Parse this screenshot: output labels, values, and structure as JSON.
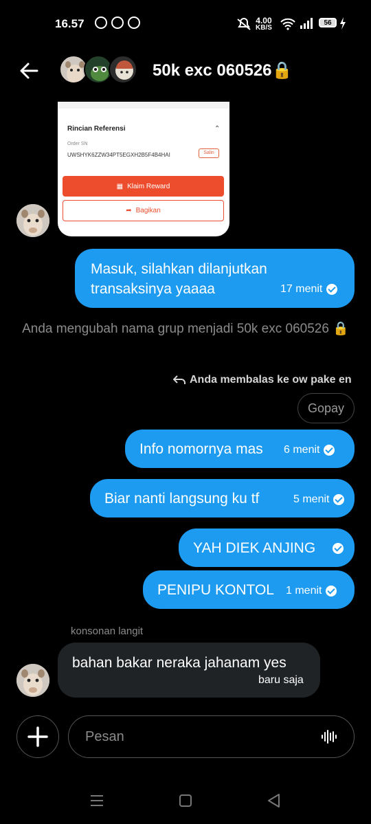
{
  "status_bar": {
    "time": "16.57",
    "speed_value": "4.00",
    "speed_unit": "KB/S",
    "battery": "56"
  },
  "header": {
    "title": "50k exc 060526🔒"
  },
  "image_card": {
    "section_title": "Rincian Referensi",
    "order_label": "Order SN",
    "order_value": "UWSHYK6ZZW34PT5EGXH2B5F4B4HAI",
    "copy_label": "Salin",
    "claim_label": "Klaim Reward",
    "share_label": "Bagikan"
  },
  "messages": [
    {
      "text": "Masuk, silahkan dilanjutkan transaksinya yaaaa",
      "time": "17 menit"
    },
    {
      "text": "Info nomornya mas",
      "time": "6 menit"
    },
    {
      "text": "Biar nanti langsung ku tf",
      "time": "5 menit"
    },
    {
      "text": "YAH DIEK ANJING",
      "time": ""
    },
    {
      "text": "PENIPU KONTOL",
      "time": "1 menit"
    }
  ],
  "system_message": "Anda mengubah nama grup menjadi 50k exc 060526 🔒",
  "reply": {
    "header": "Anda membalas ke ow pake en",
    "quoted": "Gopay"
  },
  "incoming": {
    "sender": "konsonan langit",
    "text": "bahan bakar neraka jahanam yes",
    "time": "baru saja"
  },
  "composer": {
    "placeholder": "Pesan"
  },
  "colors": {
    "accent": "#1d9bf0",
    "incoming_bubble": "#202326",
    "background": "#000000",
    "reward_button": "#ee4d2d"
  }
}
